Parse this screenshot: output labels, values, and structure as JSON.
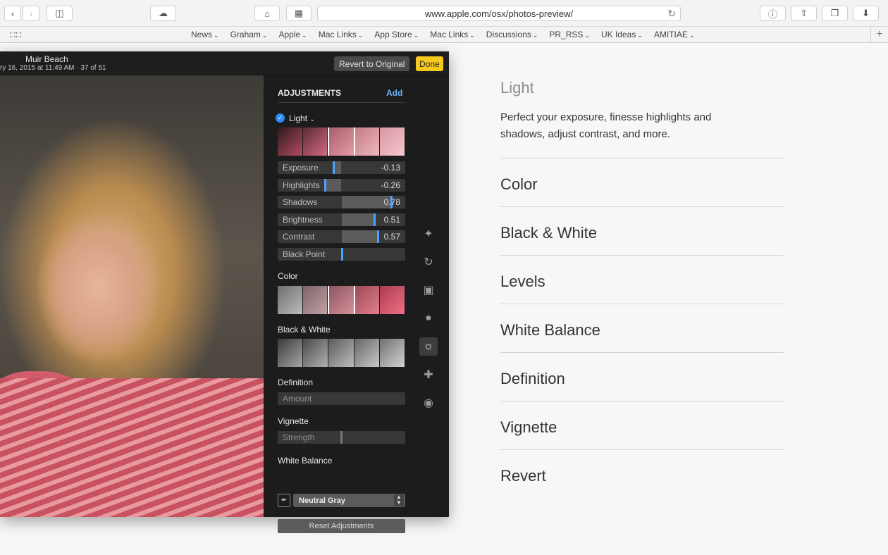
{
  "browser": {
    "url": "www.apple.com/osx/photos-preview/",
    "bookmarks": [
      "News",
      "Graham",
      "Apple",
      "Mac Links",
      "App Store",
      "Mac Links",
      "Discussions",
      "PR_RSS",
      "UK Ideas",
      "AMITIAE"
    ]
  },
  "photos": {
    "title": "Muir Beach",
    "subtitle": "ry 16, 2015 at 11:49 AM  ·  37 of 51",
    "revert_label": "Revert to Original",
    "done_label": "Done",
    "panel": {
      "heading": "ADJUSTMENTS",
      "add_label": "Add",
      "light_label": "Light",
      "sliders": [
        {
          "label": "Exposure",
          "value": "-0.13",
          "level": -0.13
        },
        {
          "label": "Highlights",
          "value": "-0.26",
          "level": -0.26
        },
        {
          "label": "Shadows",
          "value": "0.78",
          "level": 0.78
        },
        {
          "label": "Brightness",
          "value": "0.51",
          "level": 0.51
        },
        {
          "label": "Contrast",
          "value": "0.57",
          "level": 0.57
        },
        {
          "label": "Black Point",
          "value": "",
          "level": 0.0
        }
      ],
      "color_label": "Color",
      "bw_label": "Black & White",
      "definition_label": "Definition",
      "definition_slider": "Amount",
      "vignette_label": "Vignette",
      "vignette_slider": "Strength",
      "wb_label": "White Balance",
      "wb_value": "Neutral Gray",
      "reset_label": "Reset Adjustments"
    }
  },
  "content": {
    "title": "Light",
    "description": "Perfect your exposure, finesse highlights and shadows, adjust contrast, and more.",
    "items": [
      "Color",
      "Black & White",
      "Levels",
      "White Balance",
      "Definition",
      "Vignette",
      "Revert"
    ]
  }
}
